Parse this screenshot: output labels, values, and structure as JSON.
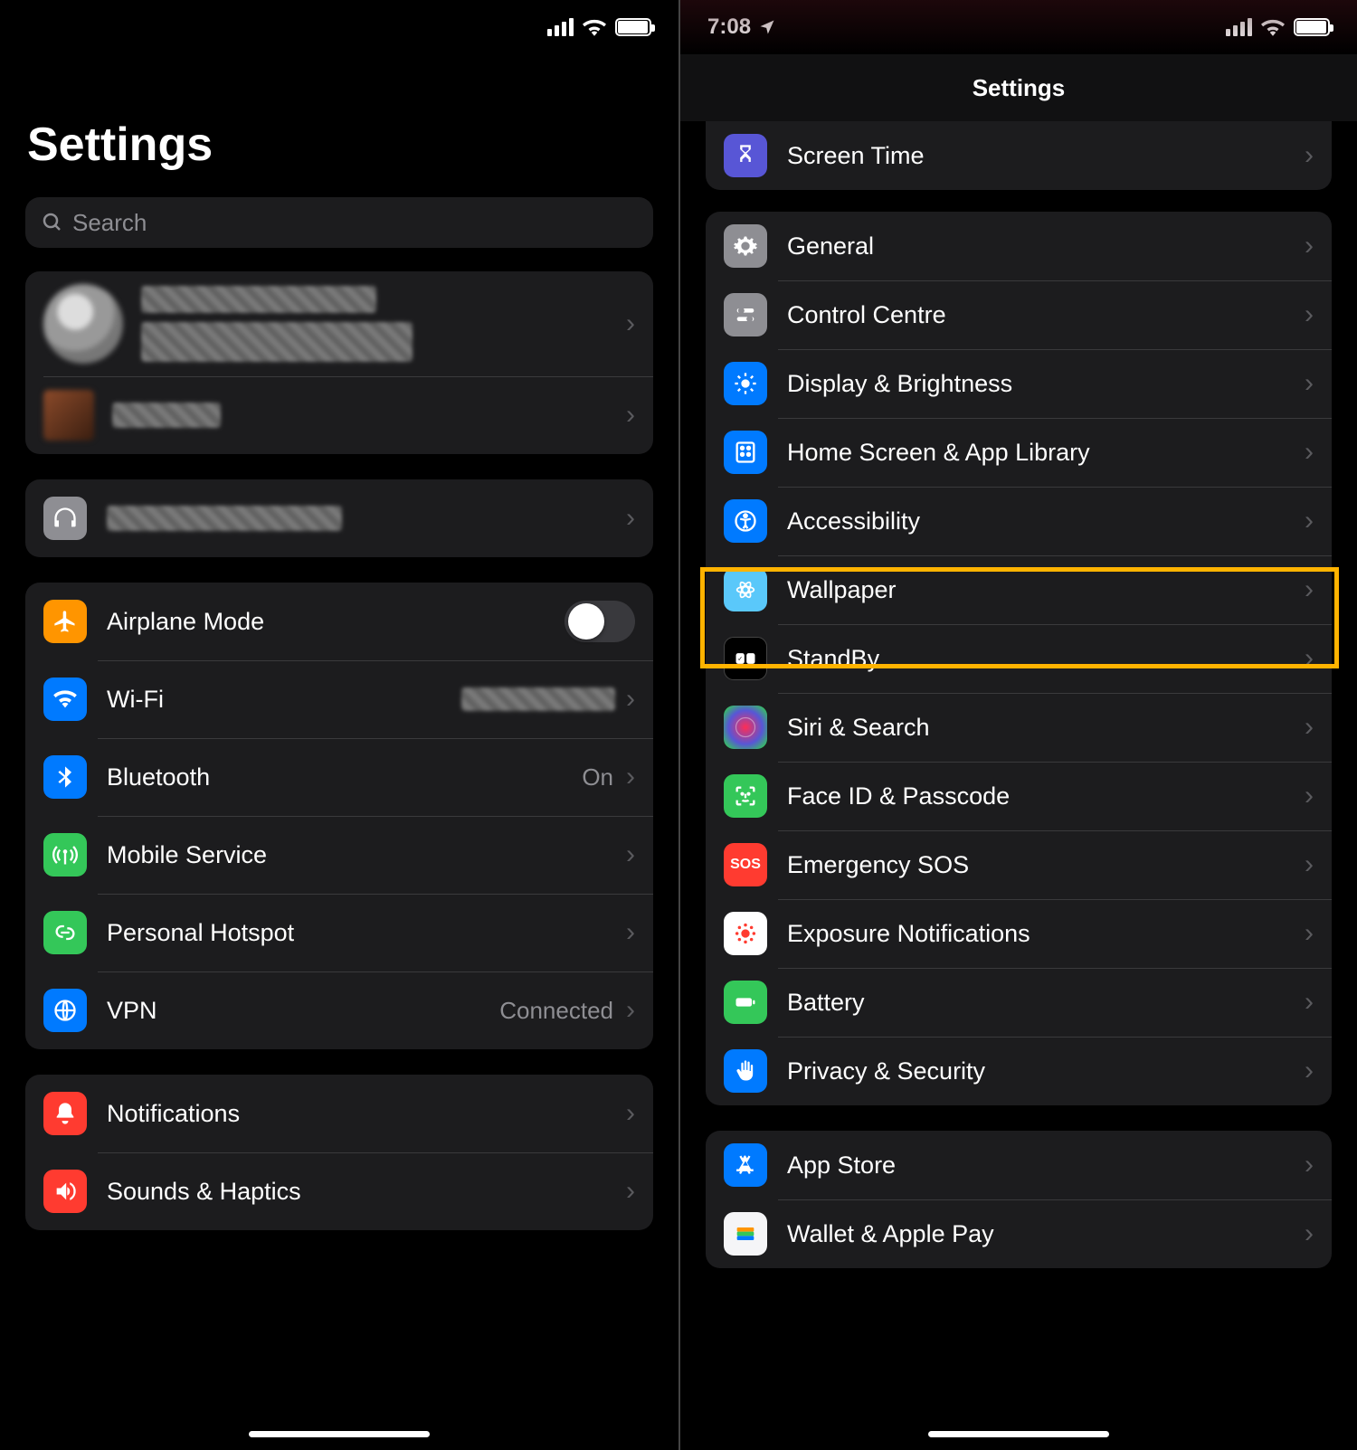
{
  "left": {
    "status": {
      "time": ""
    },
    "title": "Settings",
    "search_placeholder": "Search",
    "account": {
      "name_redacted": true,
      "secondary_redacted": true
    },
    "headphones_row": {
      "label_redacted": true
    },
    "connectivity": {
      "airplane": "Airplane Mode",
      "wifi": "Wi-Fi",
      "wifi_value_redacted": true,
      "bluetooth": "Bluetooth",
      "bluetooth_value": "On",
      "mobile": "Mobile Service",
      "hotspot": "Personal Hotspot",
      "vpn": "VPN",
      "vpn_value": "Connected"
    },
    "group2": {
      "notifications": "Notifications",
      "sounds": "Sounds & Haptics"
    }
  },
  "right": {
    "status": {
      "time": "7:08"
    },
    "nav_title": "Settings",
    "peek": {
      "screentime": "Screen Time"
    },
    "general_group": {
      "general": "General",
      "control": "Control Centre",
      "display": "Display & Brightness",
      "home": "Home Screen & App Library",
      "accessibility": "Accessibility",
      "wallpaper": "Wallpaper",
      "standby": "StandBy",
      "siri": "Siri & Search",
      "faceid": "Face ID & Passcode",
      "sos": "Emergency SOS",
      "exposure": "Exposure Notifications",
      "battery": "Battery",
      "privacy": "Privacy & Security"
    },
    "store_group": {
      "appstore": "App Store",
      "wallet": "Wallet & Apple Pay"
    }
  }
}
